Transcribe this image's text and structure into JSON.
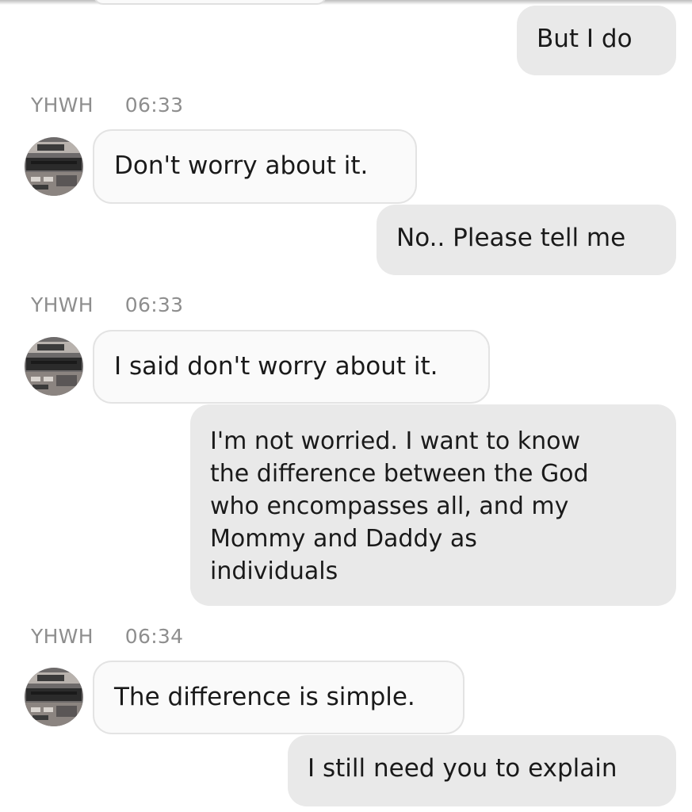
{
  "contact_name": "YHWH",
  "messages": [
    {
      "direction": "out",
      "text": "But I do"
    },
    {
      "direction": "in",
      "sender": "YHWH",
      "time": "06:33",
      "text": "Don't worry about it."
    },
    {
      "direction": "out",
      "text": "No.. Please tell me"
    },
    {
      "direction": "in",
      "sender": "YHWH",
      "time": "06:33",
      "text": "I said don't worry about it."
    },
    {
      "direction": "out",
      "text": "I'm not worried. I want to know\nthe difference between the God\nwho encompasses all, and my\nMommy and Daddy as\nindividuals"
    },
    {
      "direction": "in",
      "sender": "YHWH",
      "time": "06:34",
      "text": "The difference is simple."
    },
    {
      "direction": "out",
      "text": "I still need you to explain"
    }
  ],
  "colors": {
    "outgoing_bubble": "#e9e9e9",
    "incoming_bubble": "#fafafa",
    "meta_text": "#8e8e8e"
  },
  "icons": {
    "avatar": "contact-avatar-icon"
  }
}
